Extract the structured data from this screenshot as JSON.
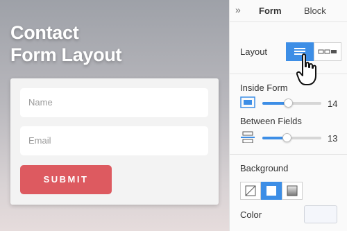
{
  "canvas": {
    "heading_line1": "Contact",
    "heading_line2": "Form Layout",
    "form": {
      "name_placeholder": "Name",
      "email_placeholder": "Email",
      "submit_label": "SUBMIT"
    },
    "colors": {
      "submit": "#dd5a60"
    }
  },
  "panel": {
    "collapse_icon": "double-chevron-right-icon",
    "tabs": [
      {
        "label": "Form",
        "active": true
      },
      {
        "label": "Block",
        "active": false
      }
    ],
    "layout": {
      "label": "Layout",
      "options": [
        {
          "icon": "stacked-layout-icon",
          "selected": true
        },
        {
          "icon": "inline-layout-icon",
          "selected": false
        }
      ]
    },
    "inside_form": {
      "label": "Inside Form",
      "value": "14",
      "fraction": 0.44
    },
    "between_fields": {
      "label": "Between Fields",
      "value": "13",
      "fraction": 0.41
    },
    "background": {
      "label": "Background",
      "options": [
        {
          "icon": "no-background-icon",
          "selected": false
        },
        {
          "icon": "solid-background-icon",
          "selected": true
        },
        {
          "icon": "gradient-background-icon",
          "selected": false
        }
      ]
    },
    "color": {
      "label": "Color",
      "value": "#f4f6fb"
    },
    "accent": "#3d8ee6"
  }
}
